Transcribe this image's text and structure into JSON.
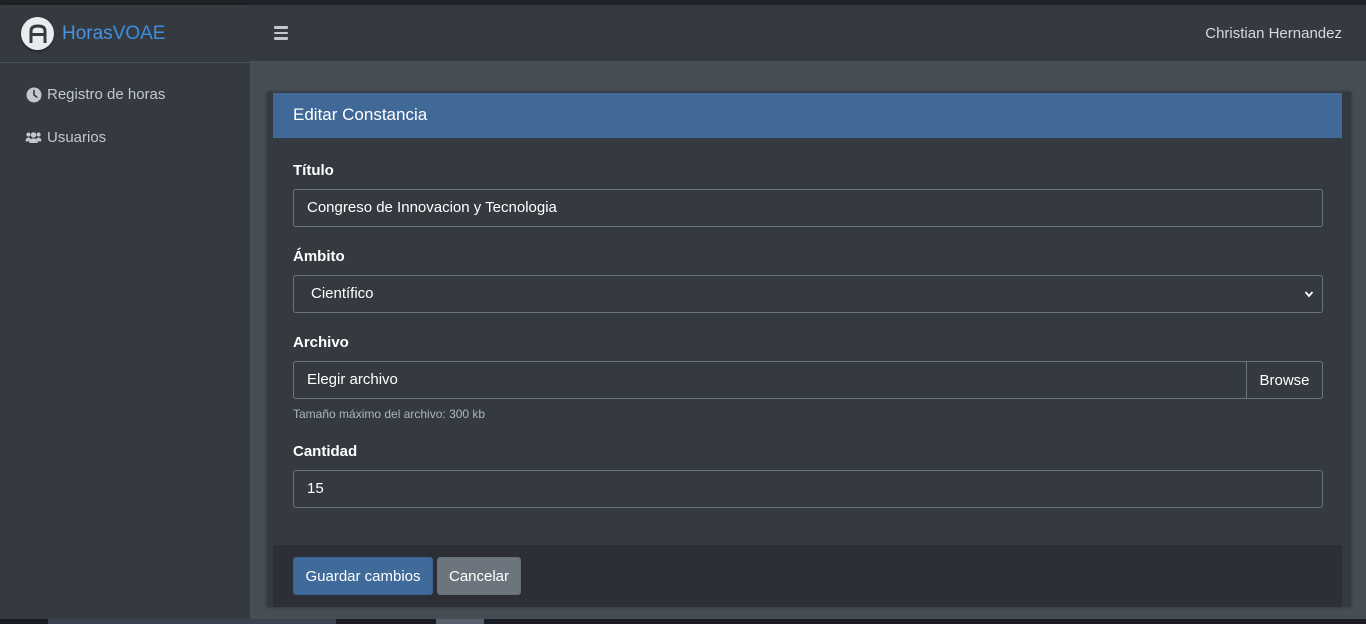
{
  "brand": {
    "name_part1": "Horas",
    "name_part2": "VOAE",
    "logo_icon": "app-logo-icon"
  },
  "sidebar": {
    "items": [
      {
        "label": "Registro de horas",
        "icon": "clock-icon"
      },
      {
        "label": "Usuarios",
        "icon": "users-icon"
      }
    ]
  },
  "header": {
    "menu_icon": "hamburger-menu-icon",
    "username": "Christian Hernandez"
  },
  "card": {
    "title": "Editar Constancia",
    "fields": {
      "titulo": {
        "label": "Título",
        "value": "Congreso de Innovacion y Tecnologia"
      },
      "ambito": {
        "label": "Ámbito",
        "selected": "Científico"
      },
      "archivo": {
        "label": "Archivo",
        "placeholder": "Elegir archivo",
        "browse_label": "Browse",
        "help": "Tamaño máximo del archivo: 300 kb"
      },
      "cantidad": {
        "label": "Cantidad",
        "value": "15"
      }
    },
    "buttons": {
      "save": "Guardar cambios",
      "cancel": "Cancelar"
    }
  },
  "colors": {
    "accent": "#416997",
    "brand_text": "#4a93e0",
    "sidebar_bg": "#343a40",
    "content_bg": "#454d55",
    "secondary_button": "#6c757d"
  }
}
